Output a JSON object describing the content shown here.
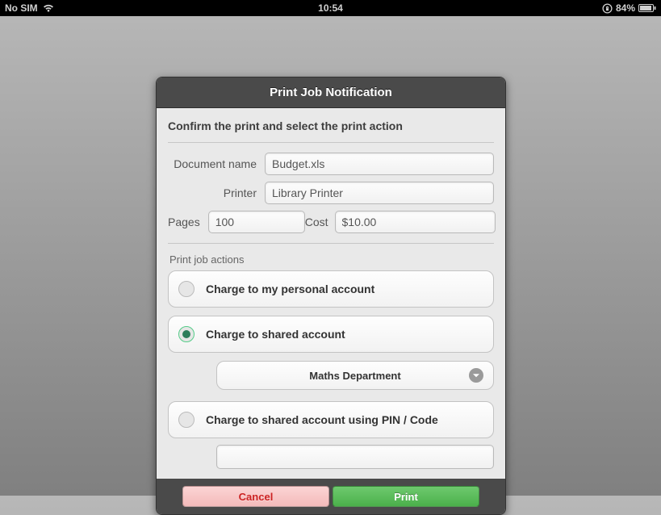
{
  "statusbar": {
    "carrier": "No SIM",
    "time": "10:54",
    "battery": "84%"
  },
  "modal": {
    "title": "Print Job Notification",
    "instruction": "Confirm the print and select the print action",
    "labels": {
      "document_name": "Document name",
      "printer": "Printer",
      "pages": "Pages",
      "cost": "Cost",
      "section": "Print job actions"
    },
    "values": {
      "document_name": "Budget.xls",
      "printer": "Library Printer",
      "pages": "100",
      "cost": "$10.00"
    },
    "options": {
      "personal": "Charge to my personal account",
      "shared": "Charge to shared account",
      "pin": "Charge to shared account using PIN / Code"
    },
    "dropdown": {
      "selected": "Maths Department"
    },
    "pin_value": "",
    "buttons": {
      "cancel": "Cancel",
      "print": "Print"
    }
  }
}
